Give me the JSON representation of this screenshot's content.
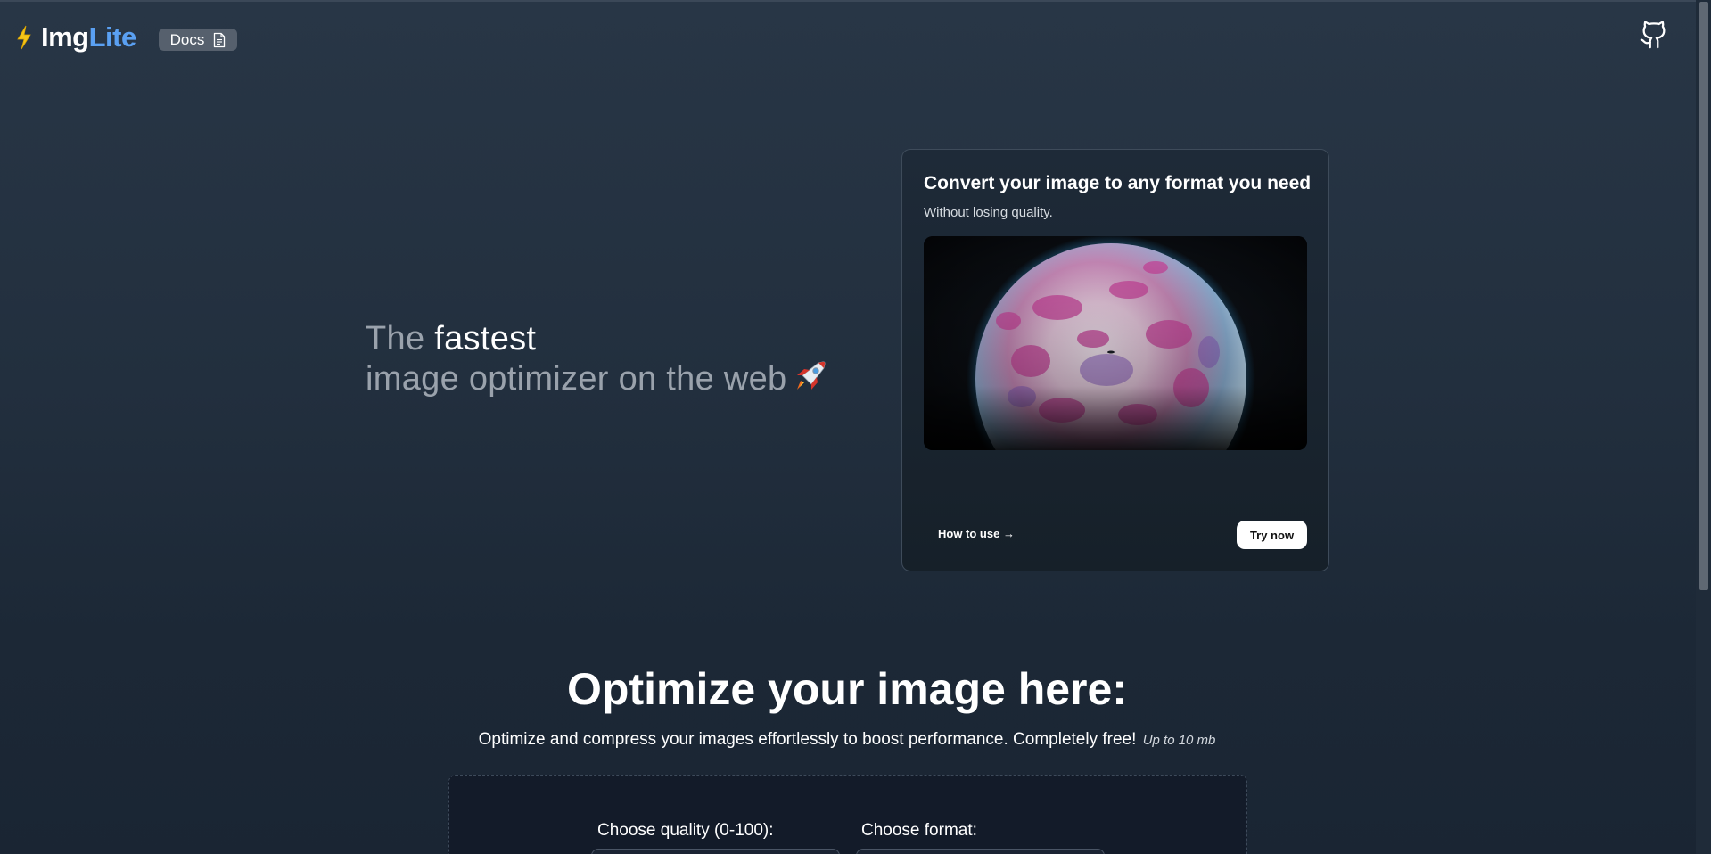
{
  "header": {
    "logo_part1": "Img",
    "logo_part2": "Lite",
    "docs_label": "Docs"
  },
  "hero": {
    "prefix": "The",
    "highlight": "fastest",
    "line2": "image optimizer on the web"
  },
  "card": {
    "title": "Convert your image to any format you need",
    "subtitle": "Without losing quality.",
    "how_to_use": "How to use →",
    "try_now": "Try now"
  },
  "optimize": {
    "title": "Optimize your image here:",
    "description": "Optimize and compress your images effortlessly to boost performance. Completely free!",
    "size_note": "Up to 10 mb",
    "quality_label": "Choose quality (0-100):",
    "format_label": "Choose format:"
  },
  "colors": {
    "accent": "#5aa0f2",
    "background": "#222f3e",
    "card_border": "#3e4b5a"
  },
  "icons": [
    "lightning-icon",
    "document-icon",
    "github-icon",
    "rocket-icon"
  ]
}
